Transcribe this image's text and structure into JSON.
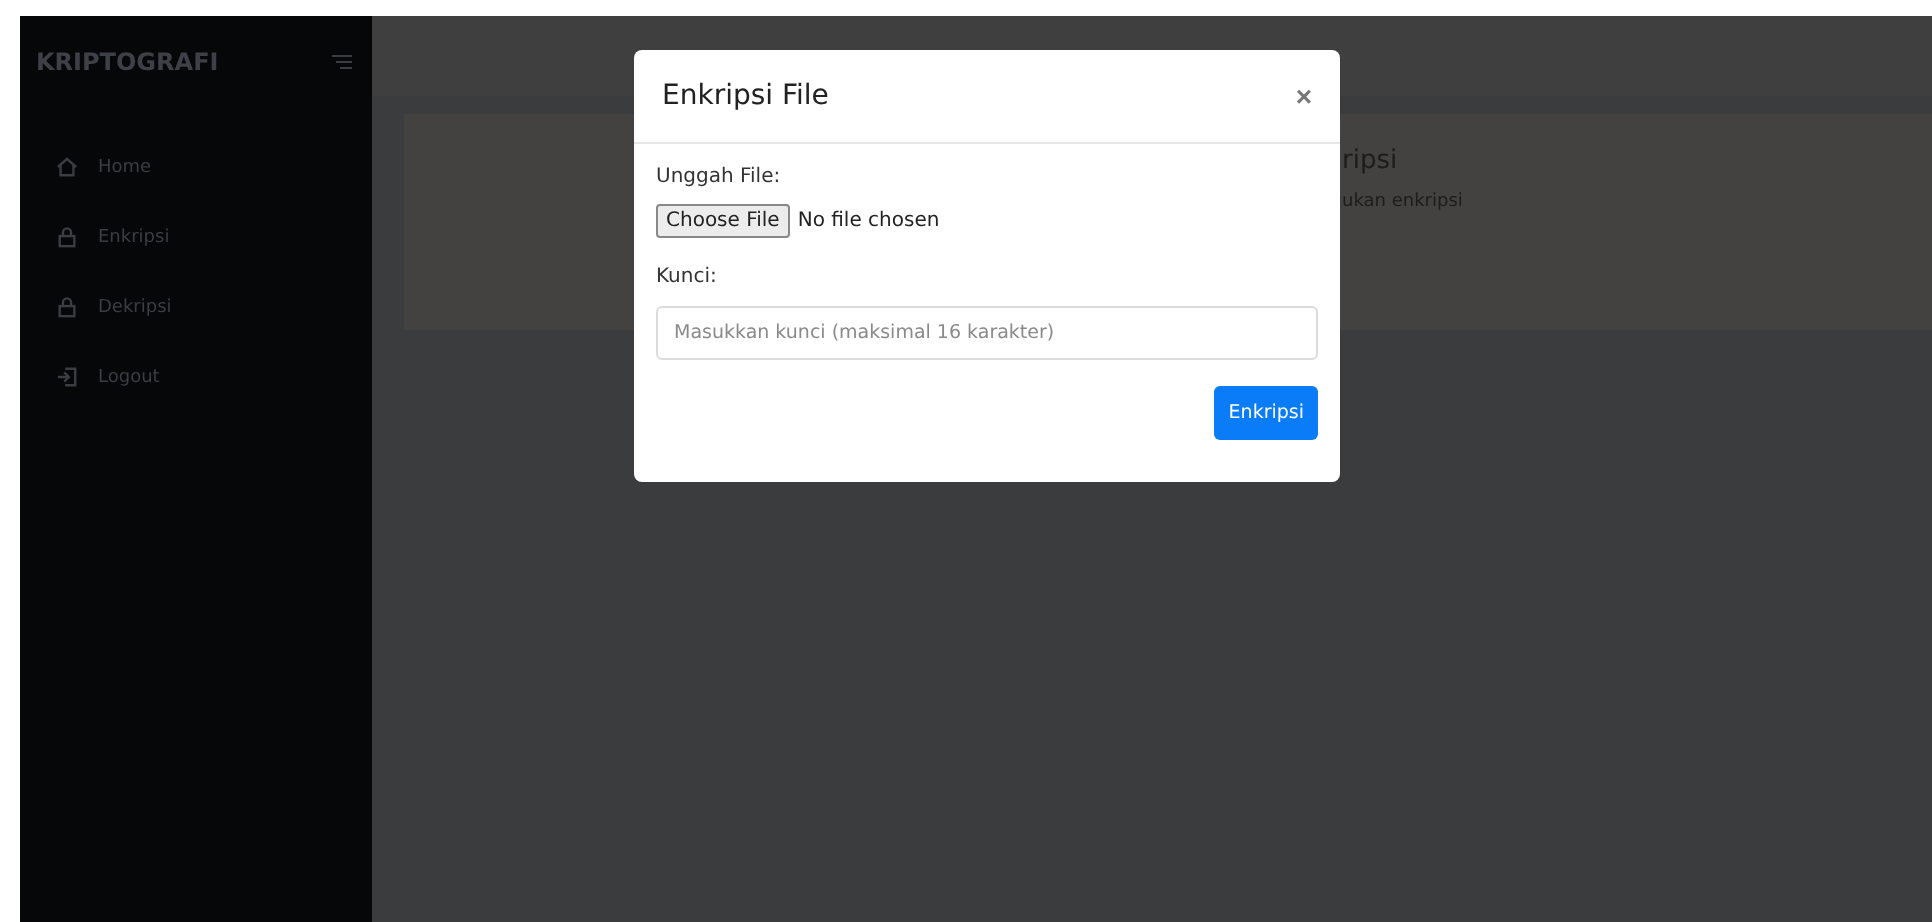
{
  "sidebar": {
    "brand": "KRIPTOGRAFI",
    "items": [
      {
        "label": "Home",
        "kind": "home"
      },
      {
        "label": "Enkripsi",
        "kind": "lock"
      },
      {
        "label": "Dekripsi",
        "kind": "lock"
      },
      {
        "label": "Logout",
        "kind": "logout"
      }
    ]
  },
  "card": {
    "title": "ripsi",
    "text": "ukan enkripsi"
  },
  "modal": {
    "title": "Enkripsi File",
    "close": "×",
    "file_label": "Unggah File:",
    "file_button": "Choose File",
    "file_status": "No file chosen",
    "key_label": "Kunci:",
    "key_placeholder": "Masukkan kunci (maksimal 16 karakter)",
    "submit": "Enkripsi"
  }
}
